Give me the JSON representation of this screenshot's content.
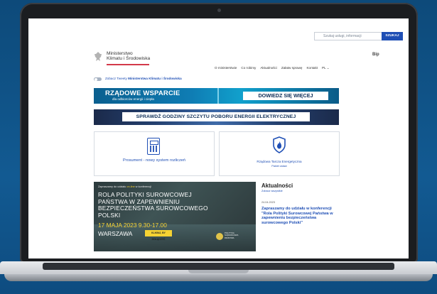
{
  "header": {
    "search_placeholder": "Szukaj usługi, informacji",
    "search_button": "SZUKAJ",
    "bip_label": "Bip",
    "ministry_name_line1": "Ministerstwo",
    "ministry_name_line2": "Klimatu i Środowiska"
  },
  "nav": {
    "items": [
      "O ministerstwie",
      "Co robimy",
      "Aktualności",
      "Załatw sprawę",
      "Kontakt",
      "PL"
    ]
  },
  "tweets": {
    "label_prefix": "Zobacz Tweety",
    "label_bold": "Ministerstwa Klimatu i Środowiska"
  },
  "banner1": {
    "title": "RZĄDOWE WSPARCIE",
    "subtitle": "dla odbiorców energii i ciepła",
    "cta": "DOWIEDZ SIĘ WIĘCEJ"
  },
  "banner2": {
    "text": "SPRAWDŹ GODZINY SZCZYTU POBORU ENERGII ELEKTRYCZNEJ"
  },
  "cards": {
    "card1_label": "Prosument - nowy system rozliczeń",
    "card2_title": "Rządowa Tarcza Energetyczna",
    "card2_sub": "Pakiet ustaw"
  },
  "conference": {
    "invite_prefix": "Zapraszamy do udziału",
    "invite_highlight": "on-line",
    "invite_suffix": "w konferencji",
    "title": "ROLA POLITYKI SUROWCOWEJ PAŃSTWA W ZAPEWNIENIU BEZPIECZEŃSTWA SUROWCOWEGO POLSKI",
    "date": "17 MAJA 2023 9.30-17.00",
    "city": "WARSZAWA",
    "cta": "KLIKNIJ, BY DOŁĄCZYĆ",
    "logo_text": "POLITYKA SUROWCOWA PAŃSTWA"
  },
  "news": {
    "heading": "Aktualności",
    "see_all": "Zobacz wszystkie",
    "date": "24.04.2023",
    "title": "Zapraszamy do udziału w konferencji \"Rola Polityki Surowcowej Państwa w zapewnieniu bezpieczeństwa surowcowego Polski\""
  },
  "colors": {
    "accent": "#1f4fb5",
    "brand_red": "#d3394a",
    "highlight_yellow": "#f6d233"
  }
}
